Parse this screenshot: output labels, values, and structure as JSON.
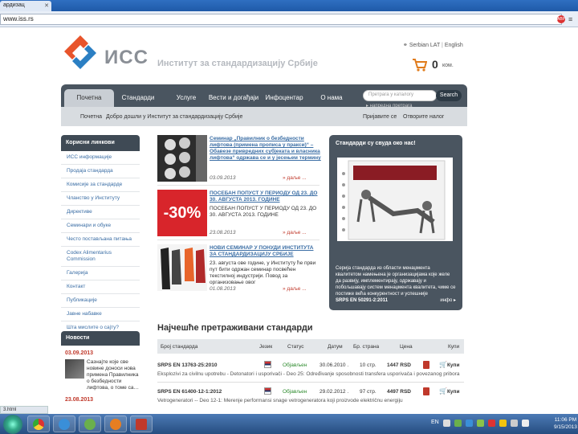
{
  "browser": {
    "tab_title": "ардизац",
    "tab_close": "✕",
    "url": "www.iss.rs",
    "ext_badge": "ABP",
    "menu_glyph": "≡",
    "status_url": "3.html"
  },
  "header": {
    "logo_text": "ИСС",
    "tagline": "Институт за стандардизацију Србије",
    "lang_serbian": "Serbian LAT",
    "lang_english": "English",
    "cart_count": "0",
    "cart_unit": "ком."
  },
  "nav": {
    "items": [
      "Почетна",
      "Стандарди",
      "Услуге",
      "Вести и догађаји",
      "Инфоцентар",
      "О нама"
    ],
    "search_placeholder": "Претрага у каталогу",
    "search_button": "Search",
    "advanced_search": "▸ напредна претрага"
  },
  "subnav": {
    "breadcrumb_home": "Почетна",
    "welcome": "Добро дошли у Институт за стандардизацију Србије",
    "login": "Пријавите се",
    "open_account": "Отворите налог"
  },
  "sidebar": {
    "heading": "Корисни линкови",
    "items": [
      "ИСС информације",
      "Продаја стандарда",
      "Комисије за стандарде",
      "Чланство у Институту",
      "Директиве",
      "Семинари и обуке",
      "Често постављана питања",
      "Codex Alimentarius Commission",
      "Галерија",
      "Контакт",
      "Публикације",
      "Јавне набавке",
      "Шта мислите о сајту?"
    ],
    "news_heading": "Новости",
    "news_date_1": "03.09.2013",
    "news_text_1": "Сазнајте које све новине доноси нова примена Правилника о безбедности лифтова, о томе са…",
    "news_date_2": "23.08.2013"
  },
  "news": [
    {
      "title": "Семинар „Правилник о безбедности лифтова (примена прописа у пракси)“ – Обавезе привредних субјеката и власника лифтова“ одржава се и у јесењем термину",
      "body": "",
      "date": "03.09.2013",
      "more": "даље ..."
    },
    {
      "title": "ПОСЕБАН ПОПУСТ У ПЕРИОДУ ОД 23. ДО 30. АВГУСТА 2013. ГОДИНЕ",
      "body": "ПОСЕБАН ПОПУСТ У ПЕРИОДУ ОД 23. ДО 30. АВГУСТА 2013. ГОДИНЕ",
      "date": "23.08.2013",
      "more": "даље ...",
      "badge": "-30%"
    },
    {
      "title": "НОВИ СЕМИНАР У ПОНУДИ ИНСТИТУТА ЗА СТАНДАРДИЗАЦИЈУ СРБИЈЕ",
      "body": "23. августа ове године, у Институту ће први пут бити одржан семинар посвећен текстилној индустрији. Повод за организовање овог",
      "date": "01.08.2013",
      "more": "даље ..."
    }
  ],
  "right_panel": {
    "title": "Стандарди су свуда око нас!",
    "text": "Серија стандарда из области менаџмента квалитетом намењена је организацијама које желе да развију, имплементирају, одржавају и побољшавају систем менаџмента квалитета, чиме се постиже већа конкурентност и успешније",
    "code": "SRPS EN 50291-2:2011",
    "more": "инфо ▸"
  },
  "table": {
    "title": "Најчешће претраживани стандарди",
    "headers": [
      "Број стандарда",
      "Језик",
      "Статус",
      "Датум",
      "Бр. страна",
      "Цена",
      "Купи"
    ],
    "rows": [
      {
        "number": "SRPS EN 13763-25:2010",
        "status": "Објављен",
        "date": "30.06.2010 .",
        "pages": "10 стр.",
        "price": "1447 RSD",
        "buy": "Купи",
        "desc": "Eksplozivi za civilnu upotrebu - Detonatori i usporivači - Deo 25: Određivanje sposobnosti transfera usporivača i povezanog pribora"
      },
      {
        "number": "SRPS EN 61400-12-1:2012",
        "status": "Објављен",
        "date": "29.02.2012 .",
        "pages": "97 стр.",
        "price": "4497 RSD",
        "buy": "Купи",
        "desc": "Vetrogeneratori -- Deo 12-1: Merenje performansi snage vetrogeneratora koji proizvode električnu energiju"
      }
    ]
  },
  "taskbar": {
    "lang": "EN",
    "time": "11:06 PM",
    "date": "9/15/2013"
  },
  "colors": {
    "nav_bg": "#4a5560",
    "link": "#3b6ea5",
    "accent_red": "#c0392b",
    "status_green": "#2e8b2e"
  }
}
